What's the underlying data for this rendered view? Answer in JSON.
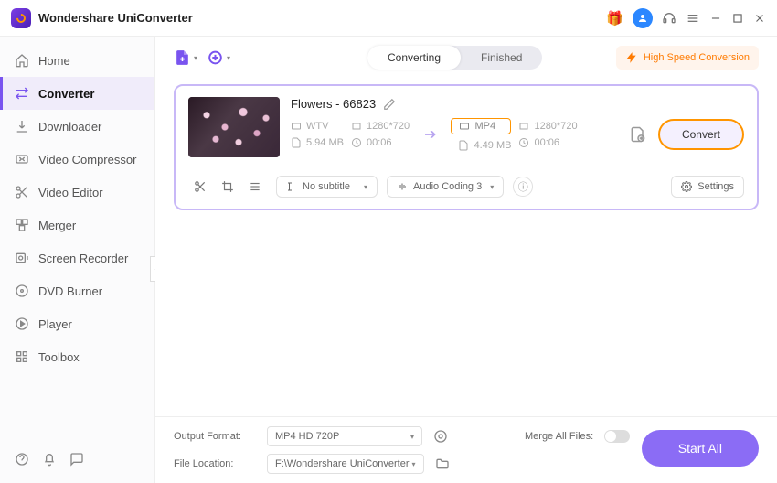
{
  "app": {
    "title": "Wondershare UniConverter"
  },
  "sidebar": {
    "items": [
      {
        "label": "Home"
      },
      {
        "label": "Converter"
      },
      {
        "label": "Downloader"
      },
      {
        "label": "Video Compressor"
      },
      {
        "label": "Video Editor"
      },
      {
        "label": "Merger"
      },
      {
        "label": "Screen Recorder"
      },
      {
        "label": "DVD Burner"
      },
      {
        "label": "Player"
      },
      {
        "label": "Toolbox"
      }
    ]
  },
  "topbar": {
    "tabs": {
      "converting": "Converting",
      "finished": "Finished"
    },
    "speed": "High Speed Conversion"
  },
  "file": {
    "name": "Flowers - 66823",
    "src": {
      "format": "WTV",
      "res": "1280*720",
      "size": "5.94 MB",
      "dur": "00:06"
    },
    "dst": {
      "format": "MP4",
      "res": "1280*720",
      "size": "4.49 MB",
      "dur": "00:06"
    },
    "convert": "Convert",
    "subtitle": "No subtitle",
    "audio": "Audio Coding 3",
    "settings": "Settings"
  },
  "footer": {
    "output_label": "Output Format:",
    "output_value": "MP4 HD 720P",
    "location_label": "File Location:",
    "location_value": "F:\\Wondershare UniConverter",
    "merge": "Merge All Files:",
    "start": "Start All"
  }
}
